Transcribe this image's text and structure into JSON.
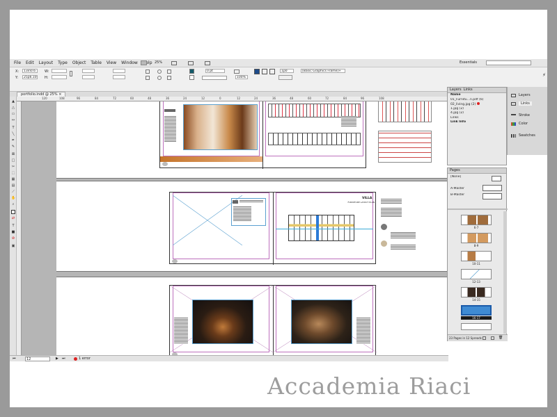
{
  "window": {
    "doc_tab": "portfolio.indd @ 25%",
    "workspace": "Essentials",
    "zoom_menu": "25%"
  },
  "menu": [
    "File",
    "Edit",
    "Layout",
    "Type",
    "Object",
    "Table",
    "View",
    "Window",
    "Help"
  ],
  "control": {
    "x_label": "X:",
    "y_label": "Y:",
    "w_label": "W:",
    "h_label": "H:",
    "x_value": "13in0.6",
    "y_value": "25p6.109",
    "w_value": "",
    "h_value": "",
    "stroke_weight": "0 pt",
    "frame_style": "[Basic Graphics Frame]+",
    "zoom_pct": "100%",
    "measure": "1p0"
  },
  "rulers": [
    "120",
    "108",
    "96",
    "84",
    "72",
    "60",
    "48",
    "36",
    "24",
    "12",
    "0",
    "12",
    "24",
    "36",
    "48",
    "60",
    "72",
    "84",
    "96",
    "108"
  ],
  "layers_panel": {
    "tabs": [
      "Layers",
      "Links"
    ],
    "col_name": "Name",
    "files": [
      "01_Furnitu...n.pdf (6)",
      "02_living.jpg (2)",
      "1.jpg (2)",
      "4.jpg (2)"
    ],
    "links_label": "Links",
    "link_info": "Link Info"
  },
  "pages_panel": {
    "title": "Pages",
    "none": "[None]",
    "a_master": "A-Master",
    "b_master": "B-Master",
    "thumbs": [
      "6-7",
      "8-9",
      "10-11",
      "12-13",
      "14-15",
      "16-17"
    ],
    "footer": "23 Pages in 12 Spreads"
  },
  "dock": [
    "Layers",
    "Links",
    "Stroke",
    "Color",
    "Swatches"
  ],
  "status": {
    "page": "12",
    "errors": "1 error"
  },
  "layout_text": {
    "p1_title": "VILLA",
    "p2_title": "FURNITURE LAYOUT PLAN"
  },
  "watermark": "Accademia Riaci"
}
